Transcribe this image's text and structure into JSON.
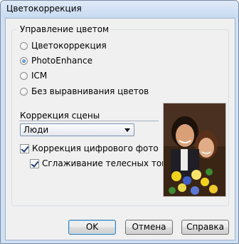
{
  "window": {
    "title": "Цветокоррекция"
  },
  "color_management": {
    "legend": "Управление цветом",
    "options": [
      {
        "label": "Цветокоррекция",
        "selected": false
      },
      {
        "label": "PhotoEnhance",
        "selected": true
      },
      {
        "label": "ICM",
        "selected": false
      },
      {
        "label": "Без выравнивания цветов",
        "selected": false
      }
    ]
  },
  "scene_correction": {
    "label": "Коррекция сцены",
    "selected_value": "Люди",
    "digital_photo_label": "Коррекция цифрового фото",
    "digital_photo_checked": true,
    "skin_smoothing_label": "Сглаживание телесных тонов",
    "skin_smoothing_checked": true
  },
  "buttons": {
    "ok": "OK",
    "cancel": "Отмена",
    "help": "Справка"
  }
}
